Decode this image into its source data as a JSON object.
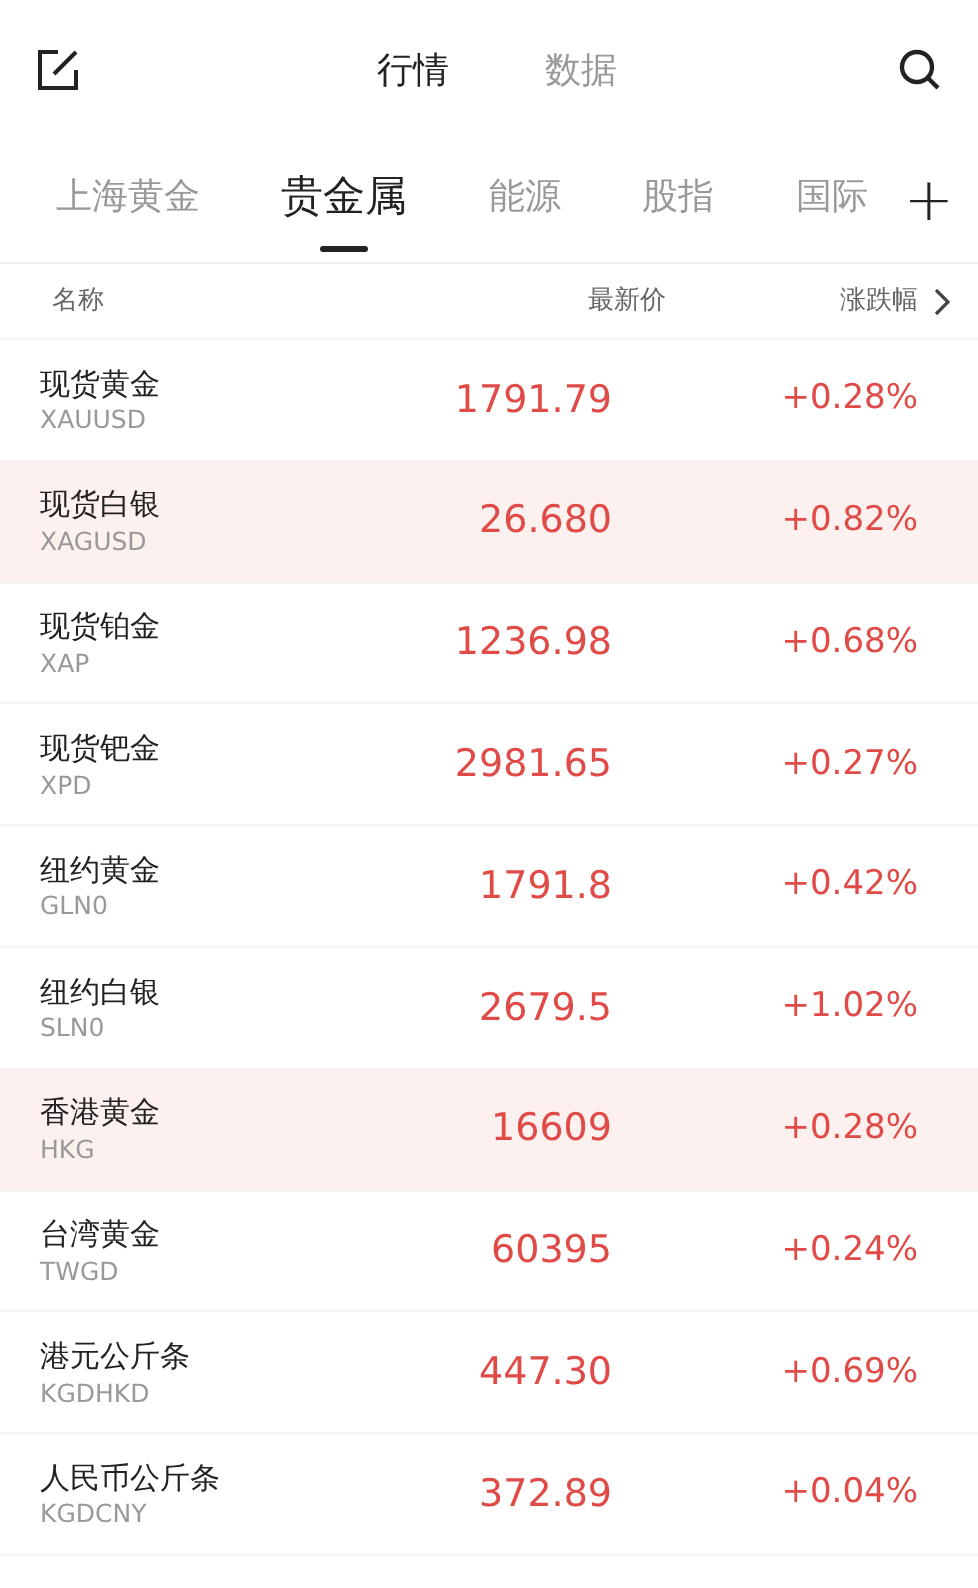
{
  "top_tabs": [
    {
      "label": "行情",
      "selected": true
    },
    {
      "label": "数据",
      "selected": false
    }
  ],
  "category_tabs": [
    {
      "label": "上海黄金",
      "selected": false
    },
    {
      "label": "贵金属",
      "selected": true
    },
    {
      "label": "能源",
      "selected": false
    },
    {
      "label": "股指",
      "selected": false
    },
    {
      "label": "国际",
      "selected": false
    }
  ],
  "add_button": "+",
  "table": {
    "columns": [
      "名称",
      "最新价",
      "涨跌幅"
    ],
    "rows": [
      {
        "name": "现货黄金",
        "code": "XAUUSD",
        "price": "1791.79",
        "change": "+0.28%",
        "highlighted": false
      },
      {
        "name": "现货白银",
        "code": "XAGUSD",
        "price": "26.680",
        "change": "+0.82%",
        "highlighted": true
      },
      {
        "name": "现货铂金",
        "code": "XAP",
        "price": "1236.98",
        "change": "+0.68%",
        "highlighted": false
      },
      {
        "name": "现货钯金",
        "code": "XPD",
        "price": "2981.65",
        "change": "+0.27%",
        "highlighted": false
      },
      {
        "name": "纽约黄金",
        "code": "GLN0",
        "price": "1791.8",
        "change": "+0.42%",
        "highlighted": false
      },
      {
        "name": "纽约白银",
        "code": "SLN0",
        "price": "2679.5",
        "change": "+1.02%",
        "highlighted": false
      },
      {
        "name": "香港黄金",
        "code": "HKG",
        "price": "16609",
        "change": "+0.28%",
        "highlighted": true
      },
      {
        "name": "台湾黄金",
        "code": "TWGD",
        "price": "60395",
        "change": "+0.24%",
        "highlighted": false
      },
      {
        "name": "港元公斤条",
        "code": "KGDHKD",
        "price": "447.30",
        "change": "+0.69%",
        "highlighted": false
      },
      {
        "name": "人民币公斤条",
        "code": "KGDCNY",
        "price": "372.89",
        "change": "+0.04%",
        "highlighted": false
      }
    ]
  }
}
